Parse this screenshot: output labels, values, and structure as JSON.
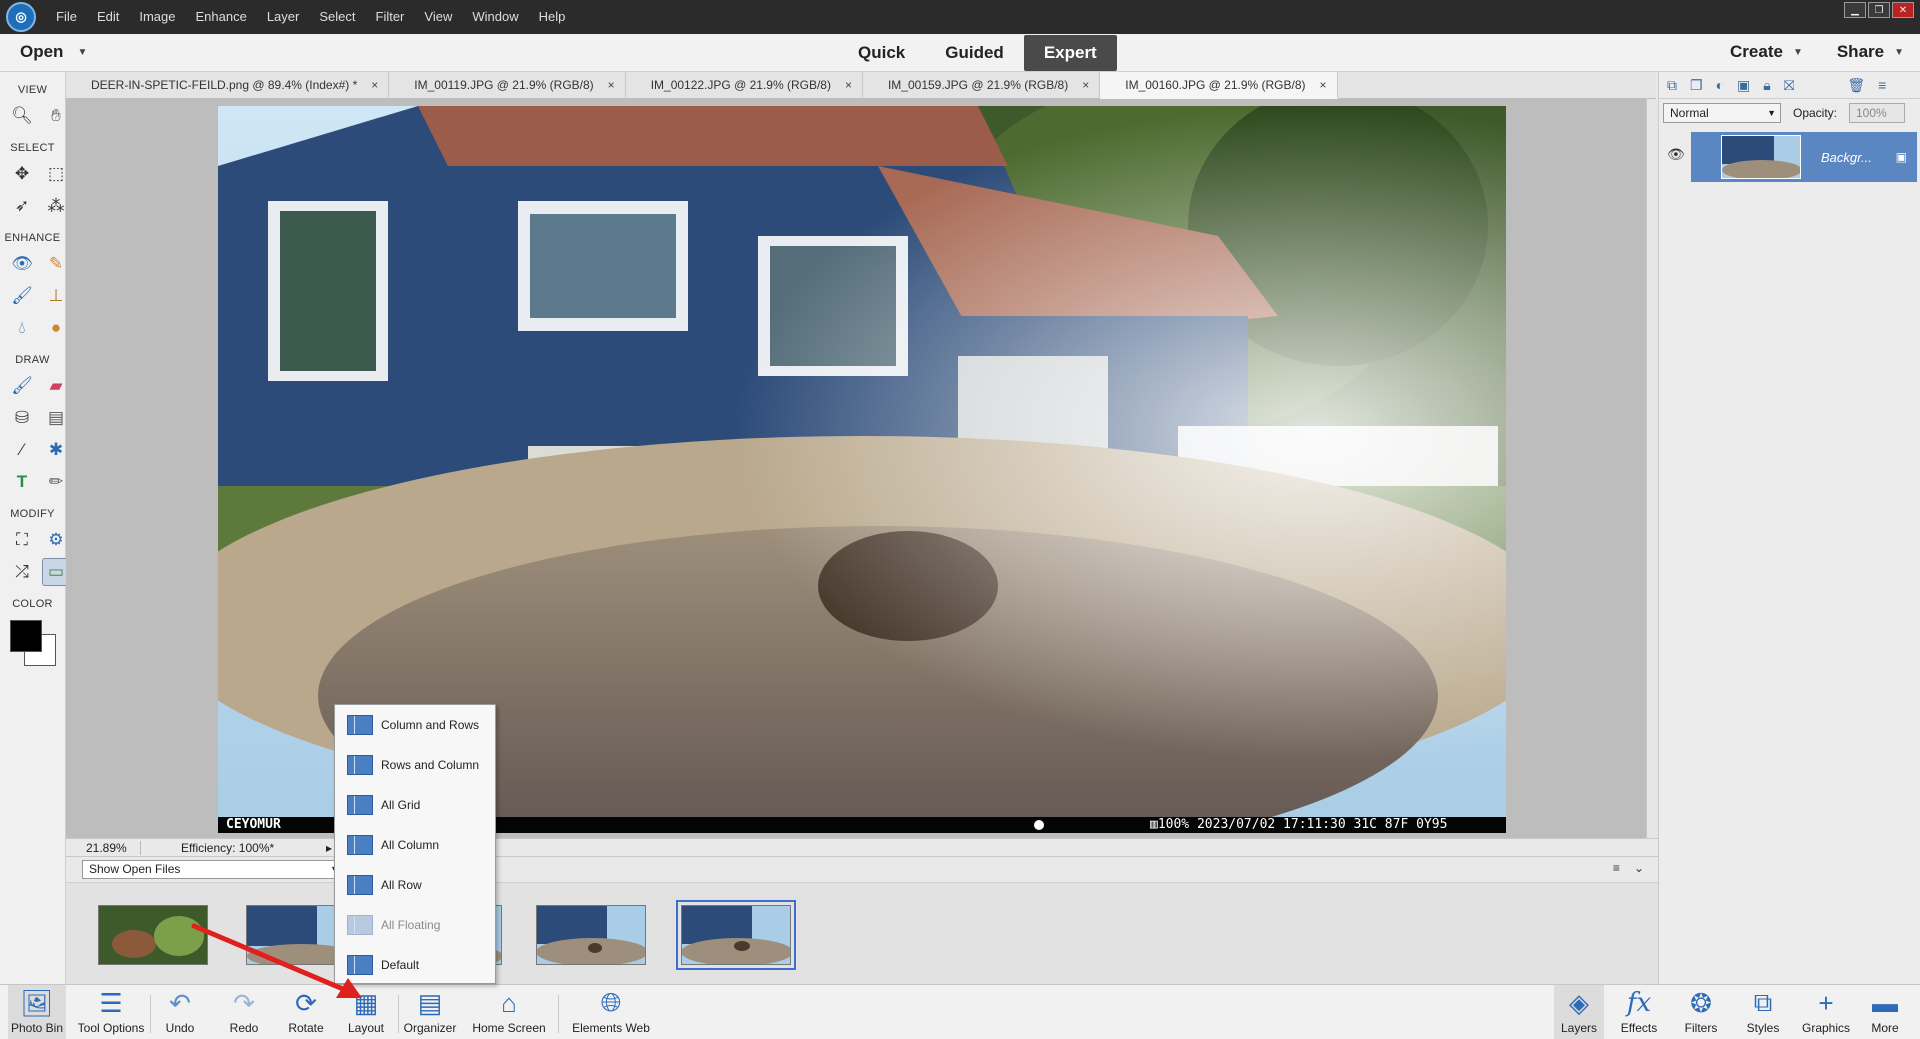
{
  "menubar": {
    "items": [
      "File",
      "Edit",
      "Image",
      "Enhance",
      "Layer",
      "Select",
      "Filter",
      "View",
      "Window",
      "Help"
    ]
  },
  "modebar": {
    "open_label": "Open",
    "modes": [
      "Quick",
      "Guided",
      "Expert"
    ],
    "active_mode": "Expert",
    "create_label": "Create",
    "share_label": "Share"
  },
  "toolbox": {
    "sections": [
      "VIEW",
      "SELECT",
      "ENHANCE",
      "DRAW",
      "MODIFY",
      "COLOR"
    ],
    "foreground_color": "#000000",
    "background_color": "#ffffff"
  },
  "doctabs": [
    {
      "title": "DEER-IN-SPETIC-FEILD.png @ 89.4% (Index#) *",
      "active": false
    },
    {
      "title": "IM_00119.JPG @ 21.9% (RGB/8)",
      "active": false
    },
    {
      "title": "IM_00122.JPG @ 21.9% (RGB/8)",
      "active": false
    },
    {
      "title": "IM_00159.JPG @ 21.9% (RGB/8)",
      "active": false
    },
    {
      "title": "IM_00160.JPG @ 21.9% (RGB/8)",
      "active": true
    }
  ],
  "photo_overlay": {
    "brand": "CEYOMUR",
    "info": "▥100%  2023/07/02 17:11:30  31C 87F 0Y95"
  },
  "status": {
    "zoom": "21.89%",
    "efficiency": "Efficiency: 100%*"
  },
  "bin": {
    "show_label": "Show Open Files"
  },
  "layers_panel": {
    "blend_mode": "Normal",
    "opacity_label": "Opacity:",
    "opacity_value": "100%",
    "layer_name": "Backgr..."
  },
  "layout_menu": {
    "items": [
      {
        "label": "Column and Rows",
        "enabled": true
      },
      {
        "label": "Rows and Column",
        "enabled": true
      },
      {
        "label": "All Grid",
        "enabled": true
      },
      {
        "label": "All Column",
        "enabled": true
      },
      {
        "label": "All Row",
        "enabled": true
      },
      {
        "label": "All Floating",
        "enabled": false
      },
      {
        "label": "Default",
        "enabled": true
      }
    ]
  },
  "taskbar": {
    "left": [
      "Photo Bin",
      "Tool Options",
      "Undo",
      "Redo",
      "Rotate",
      "Layout",
      "Organizer",
      "Home Screen",
      "Elements Web"
    ],
    "right": [
      "Layers",
      "Effects",
      "Filters",
      "Styles",
      "Graphics",
      "More"
    ]
  },
  "colors": {
    "accent": "#2d6ab8",
    "selection": "#5a86c2",
    "annotation_arrow": "#e0201c"
  }
}
